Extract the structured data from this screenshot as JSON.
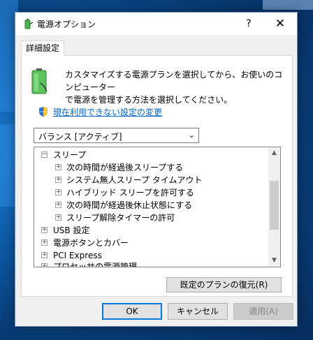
{
  "window": {
    "title": "電源オプション",
    "help_glyph": "?",
    "close_glyph": "✕"
  },
  "tab": {
    "label": "詳細設定"
  },
  "description": {
    "line1": "カスタマイズする電源プランを選択してから、お使いのコンピューター",
    "line2": "で電源を管理する方法を選択してください。"
  },
  "change_link": "現在利用できない設定の変更",
  "plan_select": {
    "value": "バランス [アクティブ]"
  },
  "tree": {
    "items": [
      {
        "label": "スリープ",
        "sign": "−"
      },
      {
        "label": "次の時間が経過後スリープする",
        "sign": "+"
      },
      {
        "label": "システム無人スリープ タイムアウト",
        "sign": "+"
      },
      {
        "label": "ハイブリッド スリープを許可する",
        "sign": "+"
      },
      {
        "label": "次の時間が経過後休止状態にする",
        "sign": "+"
      },
      {
        "label": "スリープ解除タイマーの許可",
        "sign": "+"
      },
      {
        "label": "USB 設定",
        "sign": "+"
      },
      {
        "label": "電源ボタンとカバー",
        "sign": "+"
      },
      {
        "label": "PCI Express",
        "sign": "+"
      },
      {
        "label": "プロセッサの電源管理",
        "sign": "+"
      }
    ]
  },
  "buttons": {
    "restore": "既定のプランの復元(R)",
    "ok": "OK",
    "cancel": "キャンセル",
    "apply": "適用(A)"
  },
  "colors": {
    "link": "#0066cc",
    "ok_border": "#0078d7"
  }
}
